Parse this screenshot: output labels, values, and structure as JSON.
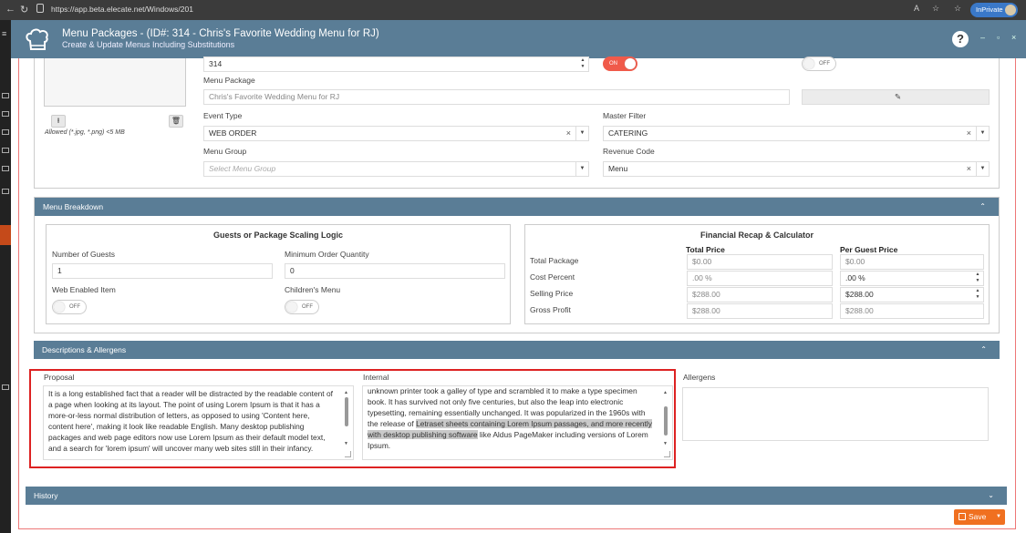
{
  "browser": {
    "url": "https://app.beta.elecate.net/Windows/201",
    "inprivate_label": "InPrivate"
  },
  "app": {
    "title": "Menu Packages - (ID#: 314 - Chris's Favorite Wedding Menu for RJ)",
    "subtitle": "Create & Update Menus Including Substitutions",
    "help_label": "?"
  },
  "details": {
    "id_value": "314",
    "toggle1_label": "ON",
    "toggle2_label": "OFF",
    "image_hint": "Allowed (*.jpg, *.png) <5 MB",
    "menu_package_label": "Menu Package",
    "menu_package_placeholder": "Chris's Favorite Wedding Menu for RJ",
    "event_type_label": "Event Type",
    "event_type_value": "WEB ORDER",
    "master_filter_label": "Master Filter",
    "master_filter_value": "CATERING",
    "menu_group_label": "Menu Group",
    "menu_group_placeholder": "Select Menu Group",
    "revenue_code_label": "Revenue Code",
    "revenue_code_value": "Menu"
  },
  "breakdown": {
    "header": "Menu Breakdown",
    "scaling": {
      "title": "Guests or Package Scaling Logic",
      "guests_label": "Number of Guests",
      "guests_value": "1",
      "min_qty_label": "Minimum Order Quantity",
      "min_qty_value": "0",
      "web_enabled_label": "Web Enabled Item",
      "web_enabled_toggle": "OFF",
      "childrens_menu_label": "Children's Menu",
      "childrens_menu_toggle": "OFF"
    },
    "financial": {
      "title": "Financial Recap & Calculator",
      "col_total": "Total Price",
      "col_guest": "Per Guest Price",
      "rows": [
        {
          "label": "Total Package",
          "total": "$0.00",
          "guest": "$0.00"
        },
        {
          "label": "Cost Percent",
          "total": ".00 %",
          "guest": ".00 %"
        },
        {
          "label": "Selling Price",
          "total": "$288.00",
          "guest": "$288.00"
        },
        {
          "label": "Gross Profit",
          "total": "$288.00",
          "guest": "$288.00"
        }
      ]
    }
  },
  "descriptions": {
    "header": "Descriptions & Allergens",
    "proposal_label": "Proposal",
    "proposal_text": "It is a long established fact that a reader will be distracted by the readable content of a page when looking at its layout. The point of using Lorem Ipsum is that it has a more-or-less normal distribution of letters, as opposed to using 'Content here, content here', making it look like readable English. Many desktop publishing packages and web page editors now use Lorem Ipsum as their default model text, and a search for 'lorem ipsum' will uncover many web sites still in their infancy.",
    "internal_label": "Internal",
    "internal_text_a": "unknown printer took a galley of type and scrambled it to make a type specimen book. It has survived not only five centuries, but also the leap into electronic typesetting, remaining essentially unchanged. It was popularized in the 1960s with the release of ",
    "internal_text_hl": "Letraset sheets containing Lorem Ipsum passages, and more recently with desktop publishing software",
    "internal_text_b": " like Aldus PageMaker including versions of Lorem Ipsum.",
    "allergens_label": "Allergens"
  },
  "history": {
    "header": "History"
  },
  "footer": {
    "save_label": "Save"
  },
  "colors": {
    "header_bg": "#5a7d96",
    "toggle_on": "#f05a4a",
    "save_bg": "#f07020",
    "highlight_border": "#dd2222"
  }
}
